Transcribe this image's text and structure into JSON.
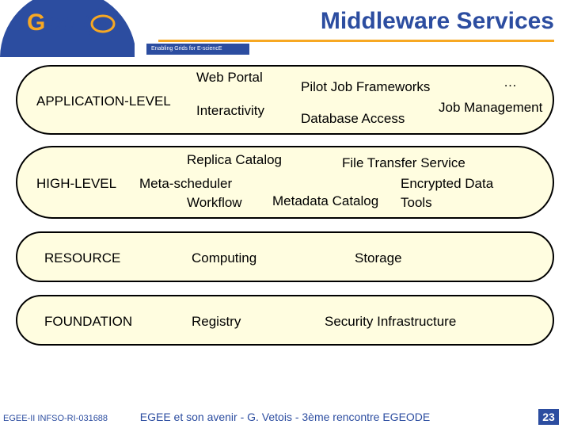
{
  "title": "Middleware Services",
  "tagline": "Enabling Grids for E-sciencE",
  "logo_text": "eGee",
  "levels": {
    "app": {
      "label": "APPLICATION-LEVEL",
      "items": {
        "web_portal": "Web Portal",
        "pilot_frameworks": "Pilot Job Frameworks",
        "ellipsis": "…",
        "interactivity": "Interactivity",
        "database_access": "Database Access",
        "job_management": "Job Management"
      }
    },
    "high": {
      "label": "HIGH-LEVEL",
      "items": {
        "replica_catalog": "Replica Catalog",
        "file_transfer": "File Transfer Service",
        "meta_scheduler": "Meta-scheduler",
        "encrypted_data": "Encrypted Data",
        "workflow": "Workflow",
        "metadata_catalog": "Metadata Catalog",
        "tools": "Tools"
      }
    },
    "resource": {
      "label": "RESOURCE",
      "items": {
        "computing": "Computing",
        "storage": "Storage"
      }
    },
    "foundation": {
      "label": "FOUNDATION",
      "items": {
        "registry": "Registry",
        "security": "Security Infrastructure"
      }
    }
  },
  "footer": {
    "left": "EGEE-II INFSO-RI-031688",
    "center": "EGEE et son avenir - G. Vetois - 3ème rencontre EGEODE",
    "page": "23"
  }
}
